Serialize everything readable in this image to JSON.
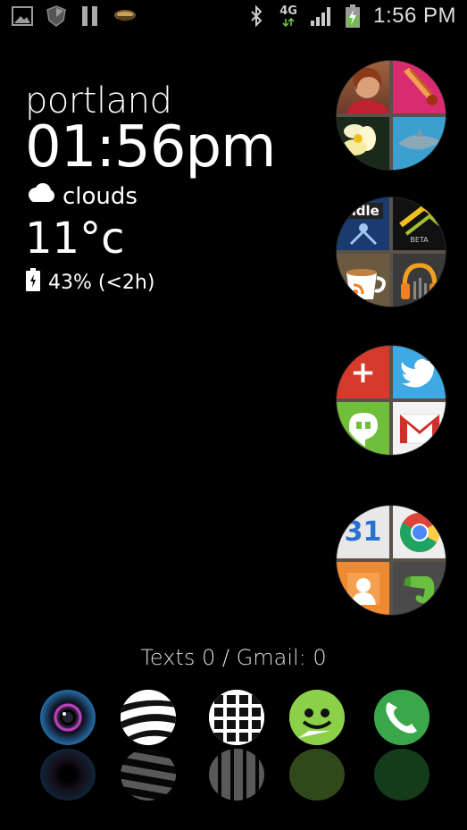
{
  "statusbar": {
    "network": "4G",
    "time": "1:56 PM",
    "icons": [
      "gallery-icon",
      "shield-icon",
      "pause-icon",
      "bowl-icon",
      "bluetooth-icon",
      "signal-icon",
      "battery-charging-icon"
    ]
  },
  "widget": {
    "city": "portland",
    "time": "01:56pm",
    "condition": "clouds",
    "temperature": "11°c",
    "battery": "43% (<2h)"
  },
  "folders": [
    {
      "name": "contacts-folder",
      "apps": [
        "contact-photo",
        "brush-app",
        "flower-photo",
        "dolphin-photo"
      ]
    },
    {
      "name": "media-folder",
      "apps": [
        "kindle-app",
        "beta-app",
        "rss-app",
        "music-app"
      ],
      "labels": {
        "kindle": "ndle",
        "beta": "BETA"
      }
    },
    {
      "name": "social-folder",
      "apps": [
        "google-plus-app",
        "twitter-app",
        "hangouts-app",
        "gmail-app"
      ],
      "labels": {
        "gplus": "+"
      }
    },
    {
      "name": "google-folder",
      "apps": [
        "calendar-app",
        "chrome-app",
        "contacts-app",
        "evernote-app"
      ],
      "labels": {
        "calendar": "31"
      }
    }
  ],
  "notification": "Texts 0 / Gmail: 0",
  "dock": [
    "camera-icon",
    "stripe-sphere-icon",
    "app-drawer-icon",
    "messaging-icon",
    "phone-icon"
  ]
}
